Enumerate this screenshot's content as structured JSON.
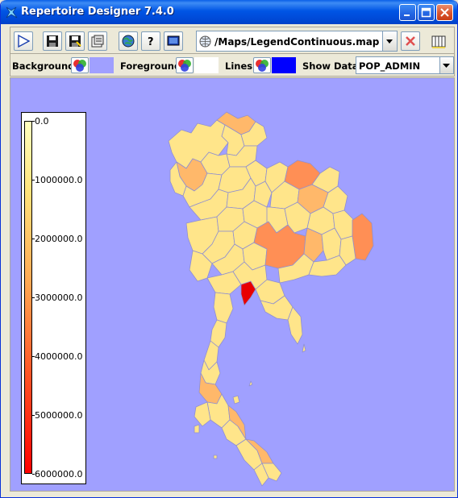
{
  "window": {
    "title": "Repertoire Designer 7.4.0"
  },
  "toolbar": {
    "map_path": "/Maps/LegendContinuous.map"
  },
  "options": {
    "background_label": "Background:",
    "background_color": "#a0a0ff",
    "foreground_label": "Foreground:",
    "foreground_color": "#ffffff",
    "lines_label": "Lines:",
    "lines_color": "#0000ff",
    "show_data_label": "Show Data:",
    "show_data_value": "POP_ADMIN"
  },
  "legend": {
    "ticks": [
      {
        "label": "0.0",
        "value": 0
      },
      {
        "label": "1000000.0",
        "value": 1000000
      },
      {
        "label": "2000000.0",
        "value": 2000000
      },
      {
        "label": "3000000.0",
        "value": 3000000
      },
      {
        "label": "4000000.0",
        "value": 4000000
      },
      {
        "label": "5000000.0",
        "value": 5000000
      },
      {
        "label": "6000000.0",
        "value": 6000000
      }
    ],
    "min": 0,
    "max": 6000000,
    "color_low": "#ffffc0",
    "color_high": "#ff0000"
  },
  "map": {
    "fill_light": "#ffe58a",
    "fill_mid": "#ffb86a",
    "fill_dark": "#ff8f55",
    "fill_max": "#e80000"
  }
}
